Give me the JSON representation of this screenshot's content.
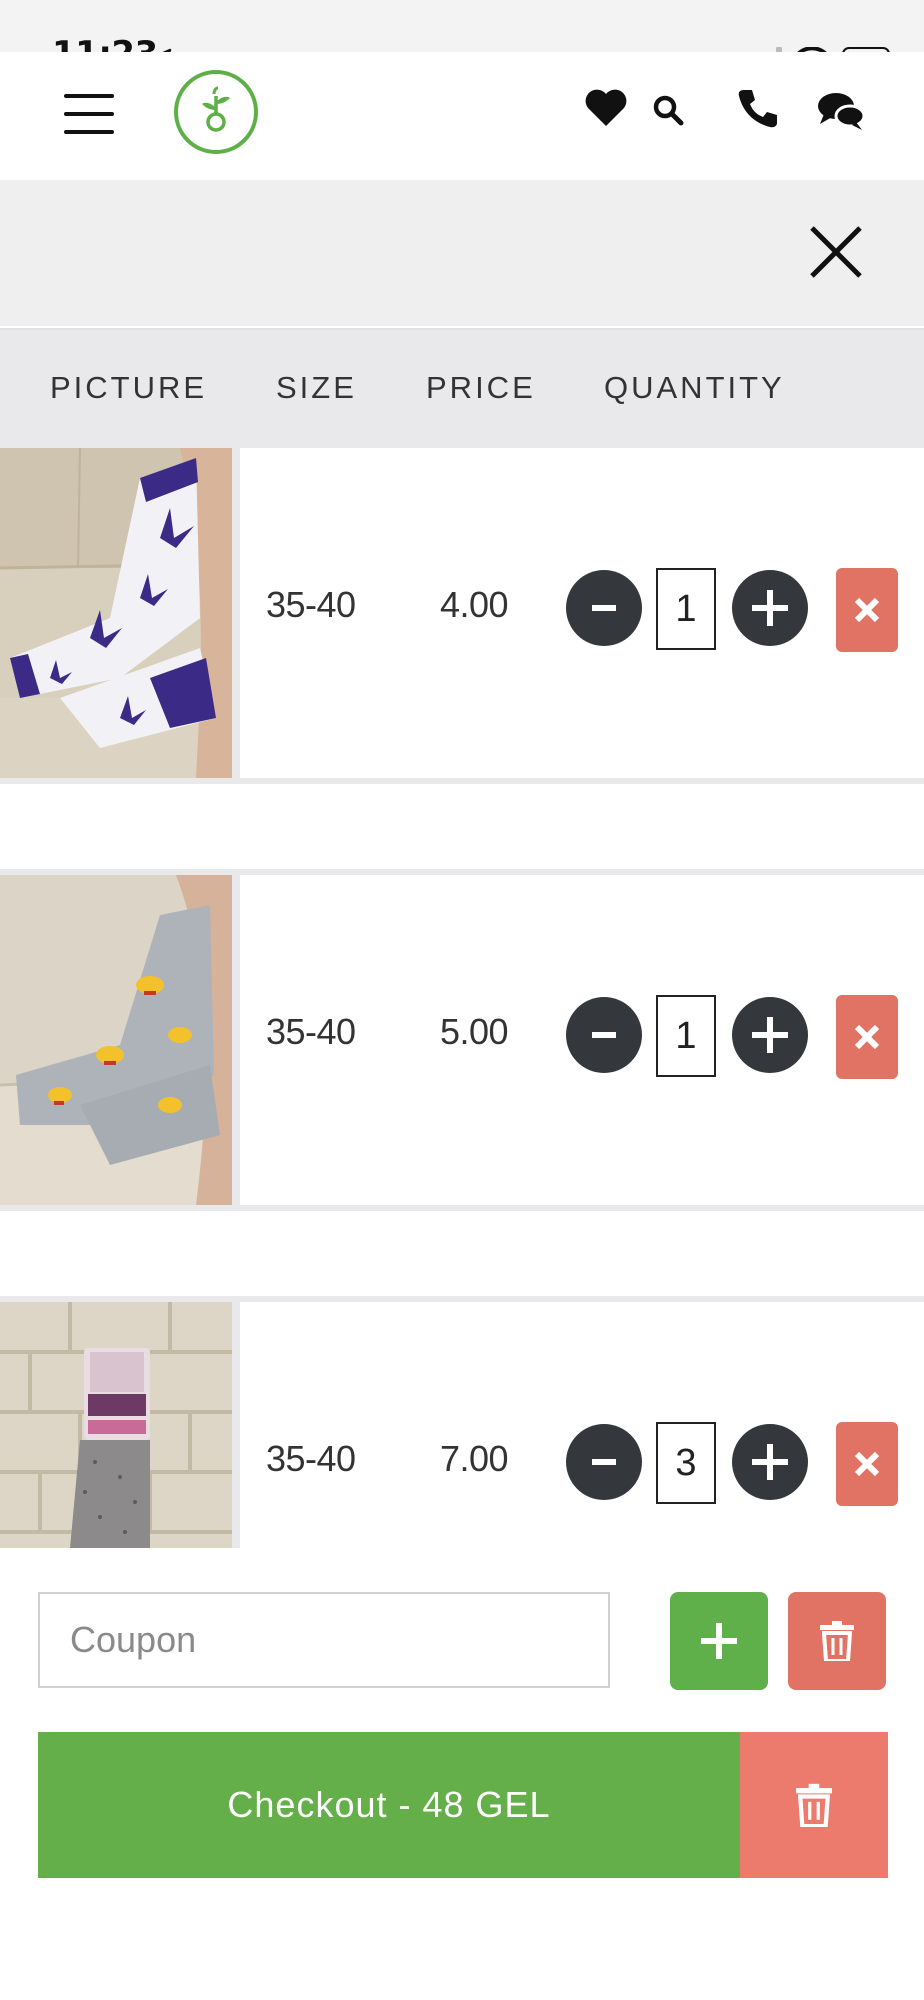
{
  "status_bar": {
    "time": "11:23"
  },
  "header": {
    "menu_icon": "hamburger-icon",
    "logo_icon": "plant-logo-icon",
    "icons": [
      "heart-icon",
      "search-icon",
      "phone-icon",
      "chat-icon"
    ]
  },
  "search_panel": {
    "close_icon": "close-icon"
  },
  "table": {
    "headers": {
      "picture": "PICTURE",
      "size": "SIZE",
      "price": "PRICE",
      "quantity": "QUANTITY"
    },
    "rows": [
      {
        "image": "white socks with purple leaf pattern",
        "size": "35-40",
        "price": "4.00",
        "quantity": "1"
      },
      {
        "image": "grey socks with cartoon character pattern",
        "size": "35-40",
        "price": "5.00",
        "quantity": "1"
      },
      {
        "image": "grey wool socks in packaging",
        "size": "35-40",
        "price": "7.00",
        "quantity": "3"
      }
    ],
    "minus_label": "-",
    "plus_label": "+"
  },
  "coupon": {
    "placeholder": "Coupon"
  },
  "checkout": {
    "label": "Checkout - 48 GEL"
  },
  "colors": {
    "green": "#5fb04a",
    "red": "#e07363",
    "dark": "#34383c",
    "panel": "#efeff0"
  }
}
